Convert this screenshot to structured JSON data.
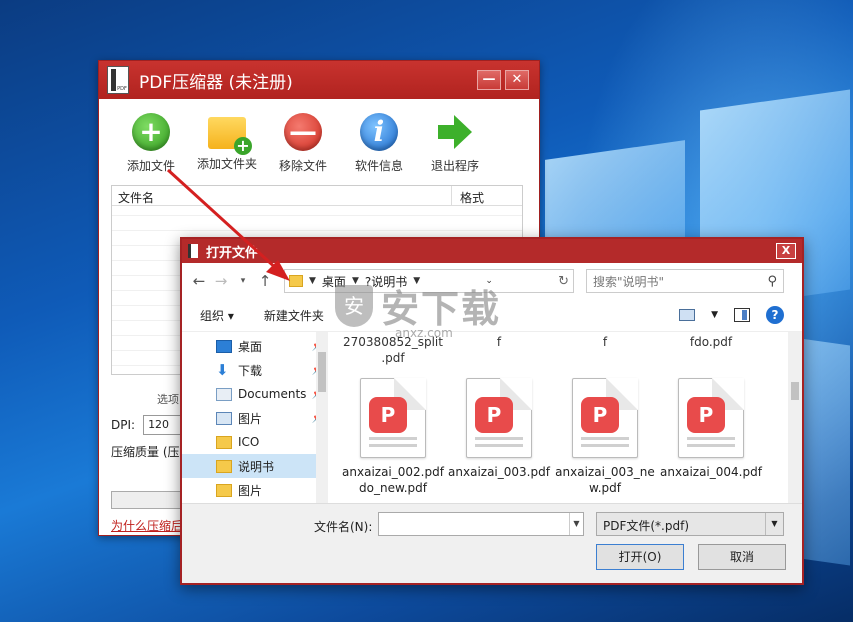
{
  "app": {
    "title": "PDF压缩器 (未注册)",
    "logo_text": "PDF",
    "minimize": "—",
    "close": "✕",
    "toolbar": [
      {
        "label": "添加文件"
      },
      {
        "label": "添加文件夹"
      },
      {
        "label": "移除文件"
      },
      {
        "label": "软件信息"
      },
      {
        "label": "退出程序"
      }
    ],
    "list_header": {
      "name": "文件名",
      "format": "格式"
    },
    "options": {
      "legend": "选项",
      "dpi_label": "DPI:",
      "dpi_value": "120",
      "quality_label": "压缩质量 (压"
    },
    "why_link": "为什么压缩后"
  },
  "dialog": {
    "title": "打开文件",
    "close": "X",
    "nav": {
      "back": "←",
      "forward": "→",
      "recent": "▾",
      "up": "↑"
    },
    "breadcrumb": [
      "桌面",
      "?说明书"
    ],
    "search_placeholder": "搜索\"说明书\"",
    "organize": "组织 ▾",
    "new_folder": "新建文件夹",
    "help": "?",
    "sidebar": [
      {
        "label": "桌面",
        "icon": "desktop-icon",
        "pinned": true
      },
      {
        "label": "下载",
        "icon": "download-icon",
        "pinned": true
      },
      {
        "label": "Documents",
        "icon": "documents-icon",
        "pinned": true
      },
      {
        "label": "图片",
        "icon": "pictures-icon",
        "pinned": true
      },
      {
        "label": "ICO",
        "icon": "folder-icon",
        "pinned": false
      },
      {
        "label": "说明书",
        "icon": "folder-icon",
        "pinned": false,
        "selected": true
      },
      {
        "label": "图片",
        "icon": "folder-icon",
        "pinned": false
      }
    ],
    "partial_names": [
      "270380852_split\n.pdf",
      "f",
      "f",
      "fdo.pdf"
    ],
    "files": [
      {
        "name": "anxaizai_002.pdfdo_new.pdf"
      },
      {
        "name": "anxaizai_003.pdf"
      },
      {
        "name": "anxaizai_003_new.pdf"
      },
      {
        "name": "anxaizai_004.pdf"
      }
    ],
    "filename_label": "文件名(N):",
    "filename_value": "",
    "filetype": "PDF文件(*.pdf)",
    "open_button": "打开(O)",
    "cancel_button": "取消"
  },
  "watermark": {
    "text": "安下载",
    "sub": "anxz.com"
  }
}
